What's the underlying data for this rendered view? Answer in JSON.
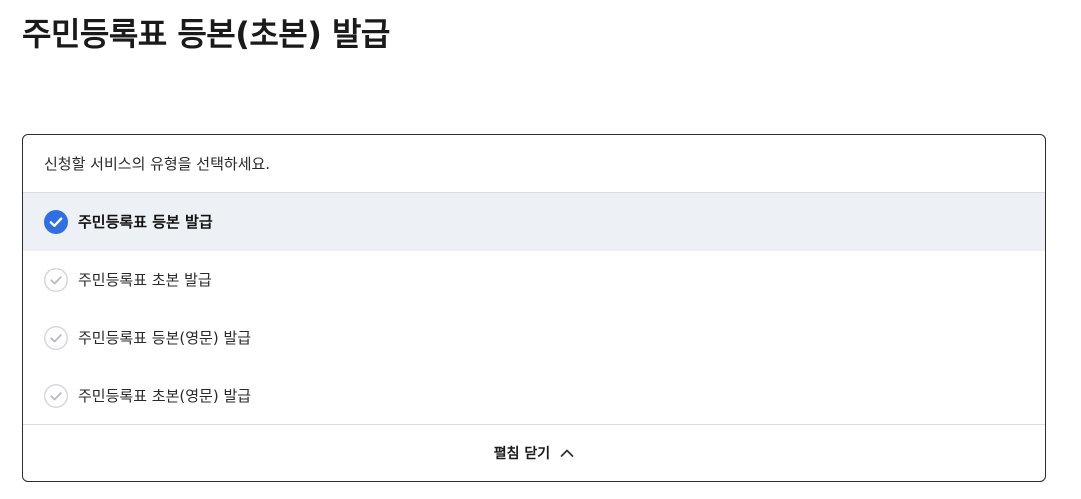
{
  "page": {
    "title": "주민등록표 등본(초본) 발급"
  },
  "selector": {
    "prompt": "신청할 서비스의 유형을 선택하세요.",
    "options": [
      {
        "label": "주민등록표 등본 발급",
        "selected": true
      },
      {
        "label": "주민등록표 초본 발급",
        "selected": false
      },
      {
        "label": "주민등록표 등본(영문) 발급",
        "selected": false
      },
      {
        "label": "주민등록표 초본(영문) 발급",
        "selected": false
      }
    ],
    "toggle_label": "펼침 닫기"
  },
  "colors": {
    "accent": "#2f6fe4",
    "selected_bg": "#edf0f4",
    "unchecked_ring": "#d4d6da"
  },
  "icons": {
    "selected": "check-circle-filled-icon",
    "unselected": "check-circle-outline-icon",
    "toggle": "chevron-up-icon"
  }
}
